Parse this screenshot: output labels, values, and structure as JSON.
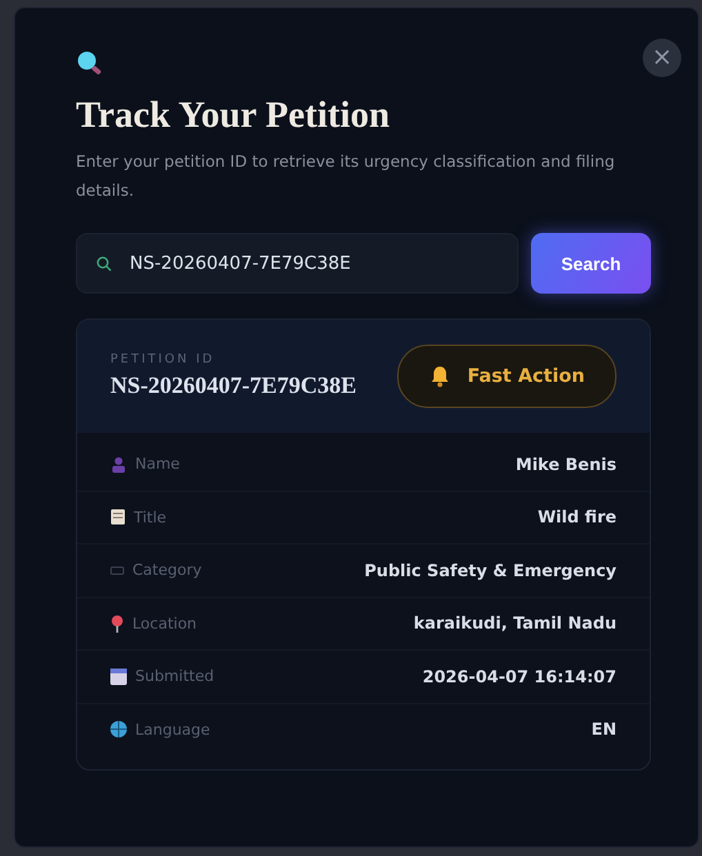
{
  "dialog": {
    "close": "×",
    "title": "Track Your Petition",
    "description": "Enter your petition ID to retrieve its urgency classification and filing details."
  },
  "search": {
    "value": "NS-20260407-7E79C38E",
    "button": "Search"
  },
  "result": {
    "id_label": "PETITION ID",
    "id": "NS-20260407-7E79C38E",
    "urgency": {
      "label": "Fast Action",
      "kind": "fast"
    },
    "details": [
      {
        "label": "Name",
        "value": "Mike Benis"
      },
      {
        "label": "Title",
        "value": "Wild fire"
      },
      {
        "label": "Category",
        "value": "Public Safety & Emergency"
      },
      {
        "label": "Location",
        "value": "karaikudi, Tamil Nadu"
      },
      {
        "label": "Submitted",
        "value": "2026-04-07 16:14:07"
      },
      {
        "label": "Language",
        "value": "EN"
      }
    ]
  }
}
